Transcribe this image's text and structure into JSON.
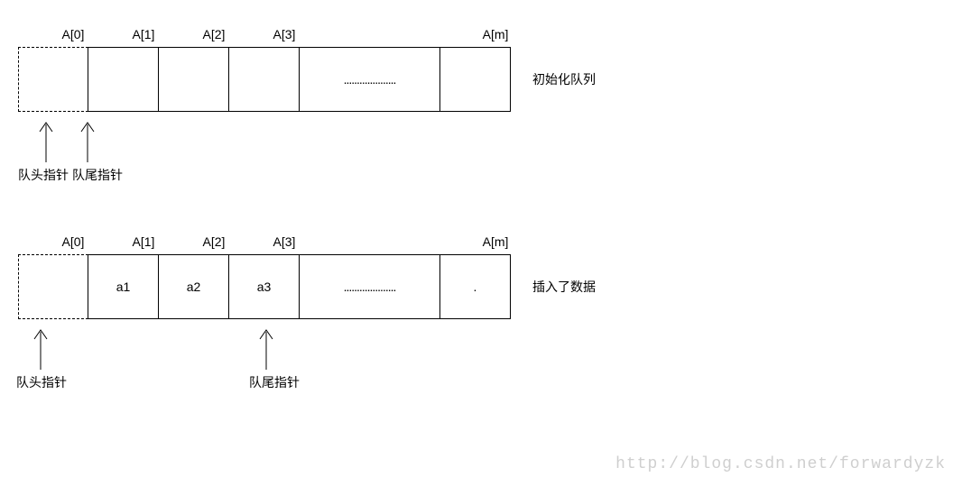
{
  "diagram1": {
    "labels": [
      "A[0]",
      "A[1]",
      "A[2]",
      "A[3]",
      "",
      "A[m]"
    ],
    "cells": [
      "",
      "",
      "",
      "",
      "....................",
      ""
    ],
    "caption": "初始化队列",
    "ptrHead": "队头指针",
    "ptrTail": "队尾指针"
  },
  "diagram2": {
    "labels": [
      "A[0]",
      "A[1]",
      "A[2]",
      "A[3]",
      "",
      "A[m]"
    ],
    "cells": [
      "",
      "a1",
      "a2",
      "a3",
      "....................",
      "."
    ],
    "caption": "插入了数据",
    "ptrHead": "队头指针",
    "ptrTail": "队尾指针"
  },
  "watermark": "http://blog.csdn.net/forwardyzk"
}
